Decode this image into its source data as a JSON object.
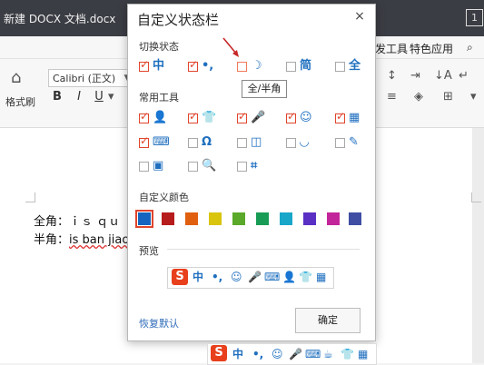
{
  "app": {
    "doc_title": "新建 DOCX 文档.docx",
    "menu": [
      "发工具",
      "特色应用"
    ],
    "font_name": "Calibri (正文)",
    "format_painter_label": "格式刷",
    "format_buttons": [
      "B",
      "I",
      "U"
    ]
  },
  "document": {
    "line1_label": "全角：",
    "line1_text": "ｉｓ ｑｕ",
    "line2_label": "半角：",
    "line2_text": "is ban jiao"
  },
  "dialog": {
    "title": "自定义状态栏",
    "close_glyph": "×",
    "section_switch": "切换状态",
    "switch_items": [
      {
        "icon": "中",
        "icon_name": "chinese-mode-icon",
        "checked": true
      },
      {
        "icon": "•,",
        "icon_name": "punctuation-icon",
        "checked": true
      },
      {
        "icon": "☽",
        "icon_name": "half-width-moon-icon",
        "checked": false
      },
      {
        "icon": "简",
        "icon_name": "simplified-icon",
        "checked": false
      },
      {
        "icon": "全",
        "icon_name": "full-shape-icon",
        "checked": false
      }
    ],
    "tooltip": "全/半角",
    "section_tools": "常用工具",
    "tool_items": [
      {
        "icon": "👤",
        "icon_name": "user-icon",
        "checked": true
      },
      {
        "icon": "👕",
        "icon_name": "skin-icon",
        "checked": true
      },
      {
        "icon": "🎤",
        "icon_name": "microphone-icon",
        "checked": true
      },
      {
        "icon": "☺",
        "icon_name": "emoji-icon",
        "checked": true
      },
      {
        "icon": "▦",
        "icon_name": "toolbox-icon",
        "checked": true
      },
      {
        "icon": "⌨",
        "icon_name": "keyboard-icon",
        "checked": true
      },
      {
        "icon": "Ω",
        "icon_name": "symbol-icon",
        "checked": false
      },
      {
        "icon": "◫",
        "icon_name": "clipboard-icon",
        "checked": false
      },
      {
        "icon": "◡",
        "icon_name": "face-icon",
        "checked": false
      },
      {
        "icon": "✎",
        "icon_name": "pen-icon",
        "checked": false
      },
      {
        "icon": "▣",
        "icon_name": "screenshot-icon",
        "checked": false
      },
      {
        "icon": "🔍",
        "icon_name": "search-icon",
        "checked": false
      },
      {
        "icon": "⌗",
        "icon_name": "crop-icon",
        "checked": false
      }
    ],
    "section_colors": "自定义颜色",
    "colors": [
      "#1565c0",
      "#b71c1c",
      "#e06010",
      "#d9c40e",
      "#5aa92a",
      "#199c56",
      "#18a7c9",
      "#5a2fc4",
      "#c2259a",
      "#3f4ea3"
    ],
    "selected_color_index": 0,
    "section_preview": "预览",
    "preview_icons": [
      "中",
      "•,",
      "☺",
      "🎤",
      "⌨",
      "👤",
      "👕",
      "▦"
    ],
    "restore_label": "恢复默认",
    "ok_label": "确定"
  },
  "statusbar": {
    "logo": "S",
    "icons": [
      "中",
      "•,",
      "☺",
      "🎤",
      "⌨",
      "☕",
      "👕",
      "▦"
    ]
  }
}
